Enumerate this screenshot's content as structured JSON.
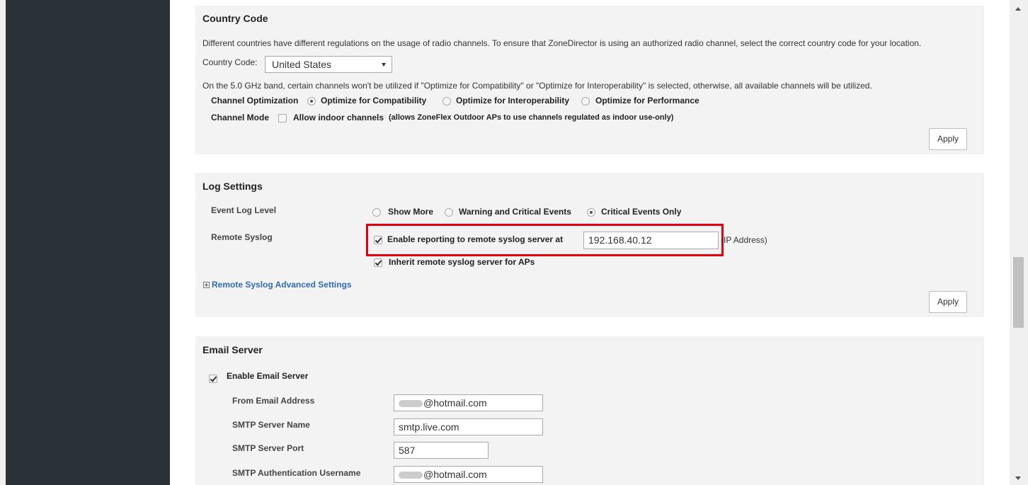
{
  "country_code": {
    "title": "Country Code",
    "description": "Different countries have different regulations on the usage of radio channels. To ensure that ZoneDirector is using an authorized radio channel, select the correct country code for your location.",
    "field_label": "Country Code:",
    "selected": "United States",
    "band_note": "On the 5.0 GHz band, certain channels won't be utilized if \"Optimize for Compatibility\" or \"Optimize for Interoperability\" is selected, otherwise, all available channels will be utilized.",
    "channel_optimization_label": "Channel Optimization",
    "optimization_options": [
      {
        "label": "Optimize for Compatibility",
        "checked": true
      },
      {
        "label": "Optimize for Interoperability",
        "checked": false
      },
      {
        "label": "Optimize for Performance",
        "checked": false
      }
    ],
    "channel_mode_label": "Channel Mode",
    "indoor_label": "Allow indoor channels",
    "indoor_note": "(allows ZoneFlex Outdoor APs to use channels regulated as indoor use-only)",
    "indoor_checked": false,
    "apply_label": "Apply"
  },
  "log_settings": {
    "title": "Log Settings",
    "event_log_label": "Event Log Level",
    "levels": [
      {
        "label": "Show More",
        "checked": false
      },
      {
        "label": "Warning and Critical Events",
        "checked": false
      },
      {
        "label": "Critical Events Only",
        "checked": true
      }
    ],
    "remote_syslog_label": "Remote Syslog",
    "enable_reporting_label": "Enable reporting to remote syslog server at",
    "enable_reporting_checked": true,
    "server_ip": "192.168.40.12",
    "ip_hint": "(IP Address)",
    "inherit_label": "Inherit remote syslog server for APs",
    "inherit_checked": true,
    "advanced_link": "Remote Syslog Advanced Settings",
    "apply_label": "Apply"
  },
  "email_server": {
    "title": "Email Server",
    "enable_label": "Enable Email Server",
    "enable_checked": true,
    "fields": {
      "from_label": "From Email Address",
      "from_value": "@hotmail.com",
      "smtp_name_label": "SMTP Server Name",
      "smtp_name_value": "smtp.live.com",
      "smtp_port_label": "SMTP Server Port",
      "smtp_port_value": "587",
      "smtp_user_label": "SMTP Authentication Username",
      "smtp_user_value": "@hotmail.com"
    }
  },
  "colors": {
    "sidebar": "#2a3137",
    "panel": "#f3f3f3",
    "highlight": "#e0000f",
    "link": "#2f6bb3"
  }
}
